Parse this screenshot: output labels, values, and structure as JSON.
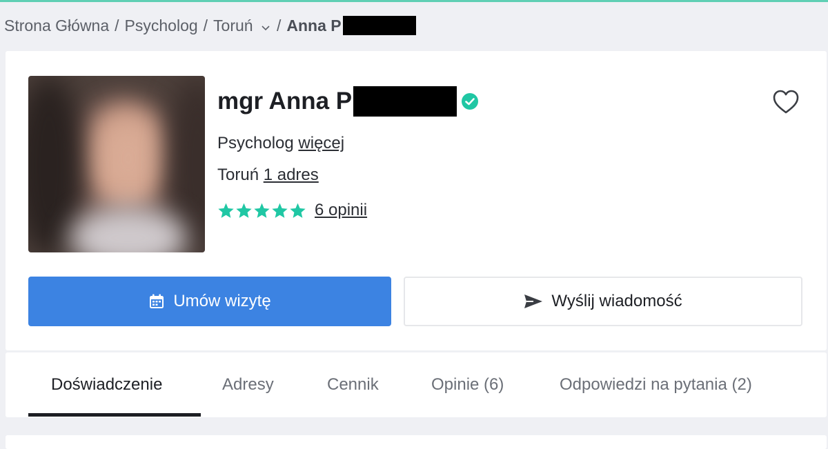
{
  "breadcrumb": {
    "home": "Strona Główna",
    "category": "Psycholog",
    "city": "Toruń",
    "current": "Anna P",
    "separator": "/"
  },
  "profile": {
    "name": "mgr Anna P",
    "specialty": "Psycholog",
    "more_link": "więcej",
    "city": "Toruń",
    "address_link": "1 adres",
    "rating_stars": 5,
    "reviews_link": "6 opinii",
    "verified": true
  },
  "actions": {
    "book_label": "Umów wizytę",
    "message_label": "Wyślij wiadomość"
  },
  "tabs": [
    {
      "label": "Doświadczenie",
      "active": true
    },
    {
      "label": "Adresy",
      "active": false
    },
    {
      "label": "Cennik",
      "active": false
    },
    {
      "label": "Opinie (6)",
      "active": false
    },
    {
      "label": "Odpowiedzi na pytania (2)",
      "active": false
    }
  ],
  "colors": {
    "accent_green": "#20c7a4",
    "primary_blue": "#3c83e2",
    "top_accent": "#5fcfb4"
  },
  "icons": {
    "verified": "verified-check-icon",
    "favorite": "heart-icon",
    "book": "calendar-icon",
    "message": "send-icon",
    "dropdown": "chevron-down-icon",
    "rating": "star-icon"
  }
}
